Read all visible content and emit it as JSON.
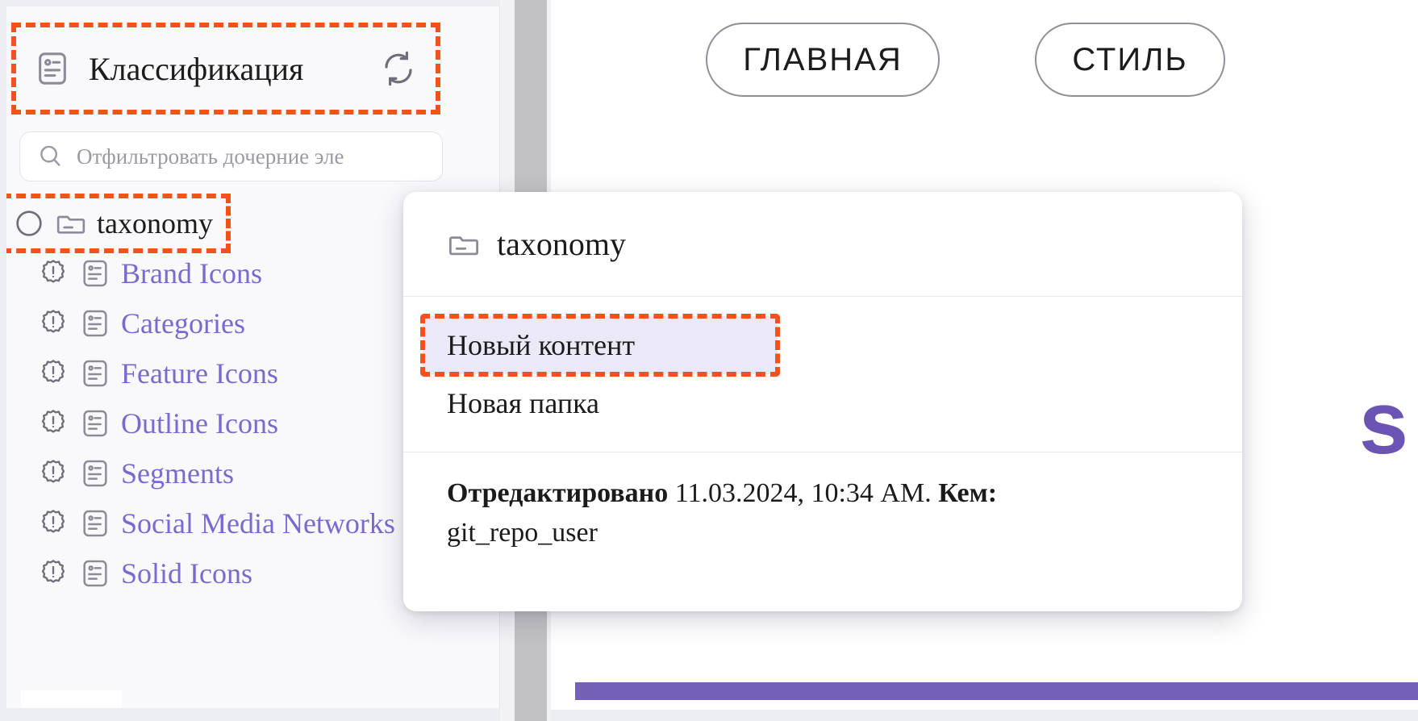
{
  "sidebar": {
    "header": {
      "icon": "document-list-icon",
      "title": "Классификация",
      "refresh_icon": "refresh-icon"
    },
    "search": {
      "icon": "search-icon",
      "placeholder": "Отфильтровать дочерние эле",
      "value": ""
    },
    "tree": {
      "root": {
        "status_icon": "loading-ring-icon",
        "type_icon": "folder-icon",
        "label": "taxonomy"
      },
      "children": [
        {
          "status_icon": "alert-badge-icon",
          "type_icon": "document-icon",
          "label": "Brand Icons"
        },
        {
          "status_icon": "alert-badge-icon",
          "type_icon": "document-icon",
          "label": "Categories"
        },
        {
          "status_icon": "alert-badge-icon",
          "type_icon": "document-icon",
          "label": "Feature Icons"
        },
        {
          "status_icon": "alert-badge-icon",
          "type_icon": "document-icon",
          "label": "Outline Icons"
        },
        {
          "status_icon": "alert-badge-icon",
          "type_icon": "document-icon",
          "label": "Segments"
        },
        {
          "status_icon": "alert-badge-icon",
          "type_icon": "document-icon",
          "label": "Social Media Networks"
        },
        {
          "status_icon": "alert-badge-icon",
          "type_icon": "document-icon",
          "label": "Solid Icons"
        }
      ]
    }
  },
  "content": {
    "pills": [
      {
        "label": "ГЛАВНАЯ"
      },
      {
        "label": "СТИЛЬ"
      }
    ],
    "big_letter": "s"
  },
  "popup": {
    "header": {
      "icon": "folder-icon",
      "title": "taxonomy"
    },
    "items": [
      {
        "label": "Новый контент",
        "selected": true
      },
      {
        "label": "Новая папка",
        "selected": false
      }
    ],
    "footer": {
      "edited_label": "Отредактировано",
      "edited_meta": " 11.03.2024, 10:34 AM. ",
      "by_label": "Кем:",
      "user": "git_repo_user"
    }
  },
  "colors": {
    "highlight": "#f4511e",
    "link": "#7c69cf",
    "accent_bar": "#7560b8",
    "selected_bg": "#ebe9f7"
  }
}
